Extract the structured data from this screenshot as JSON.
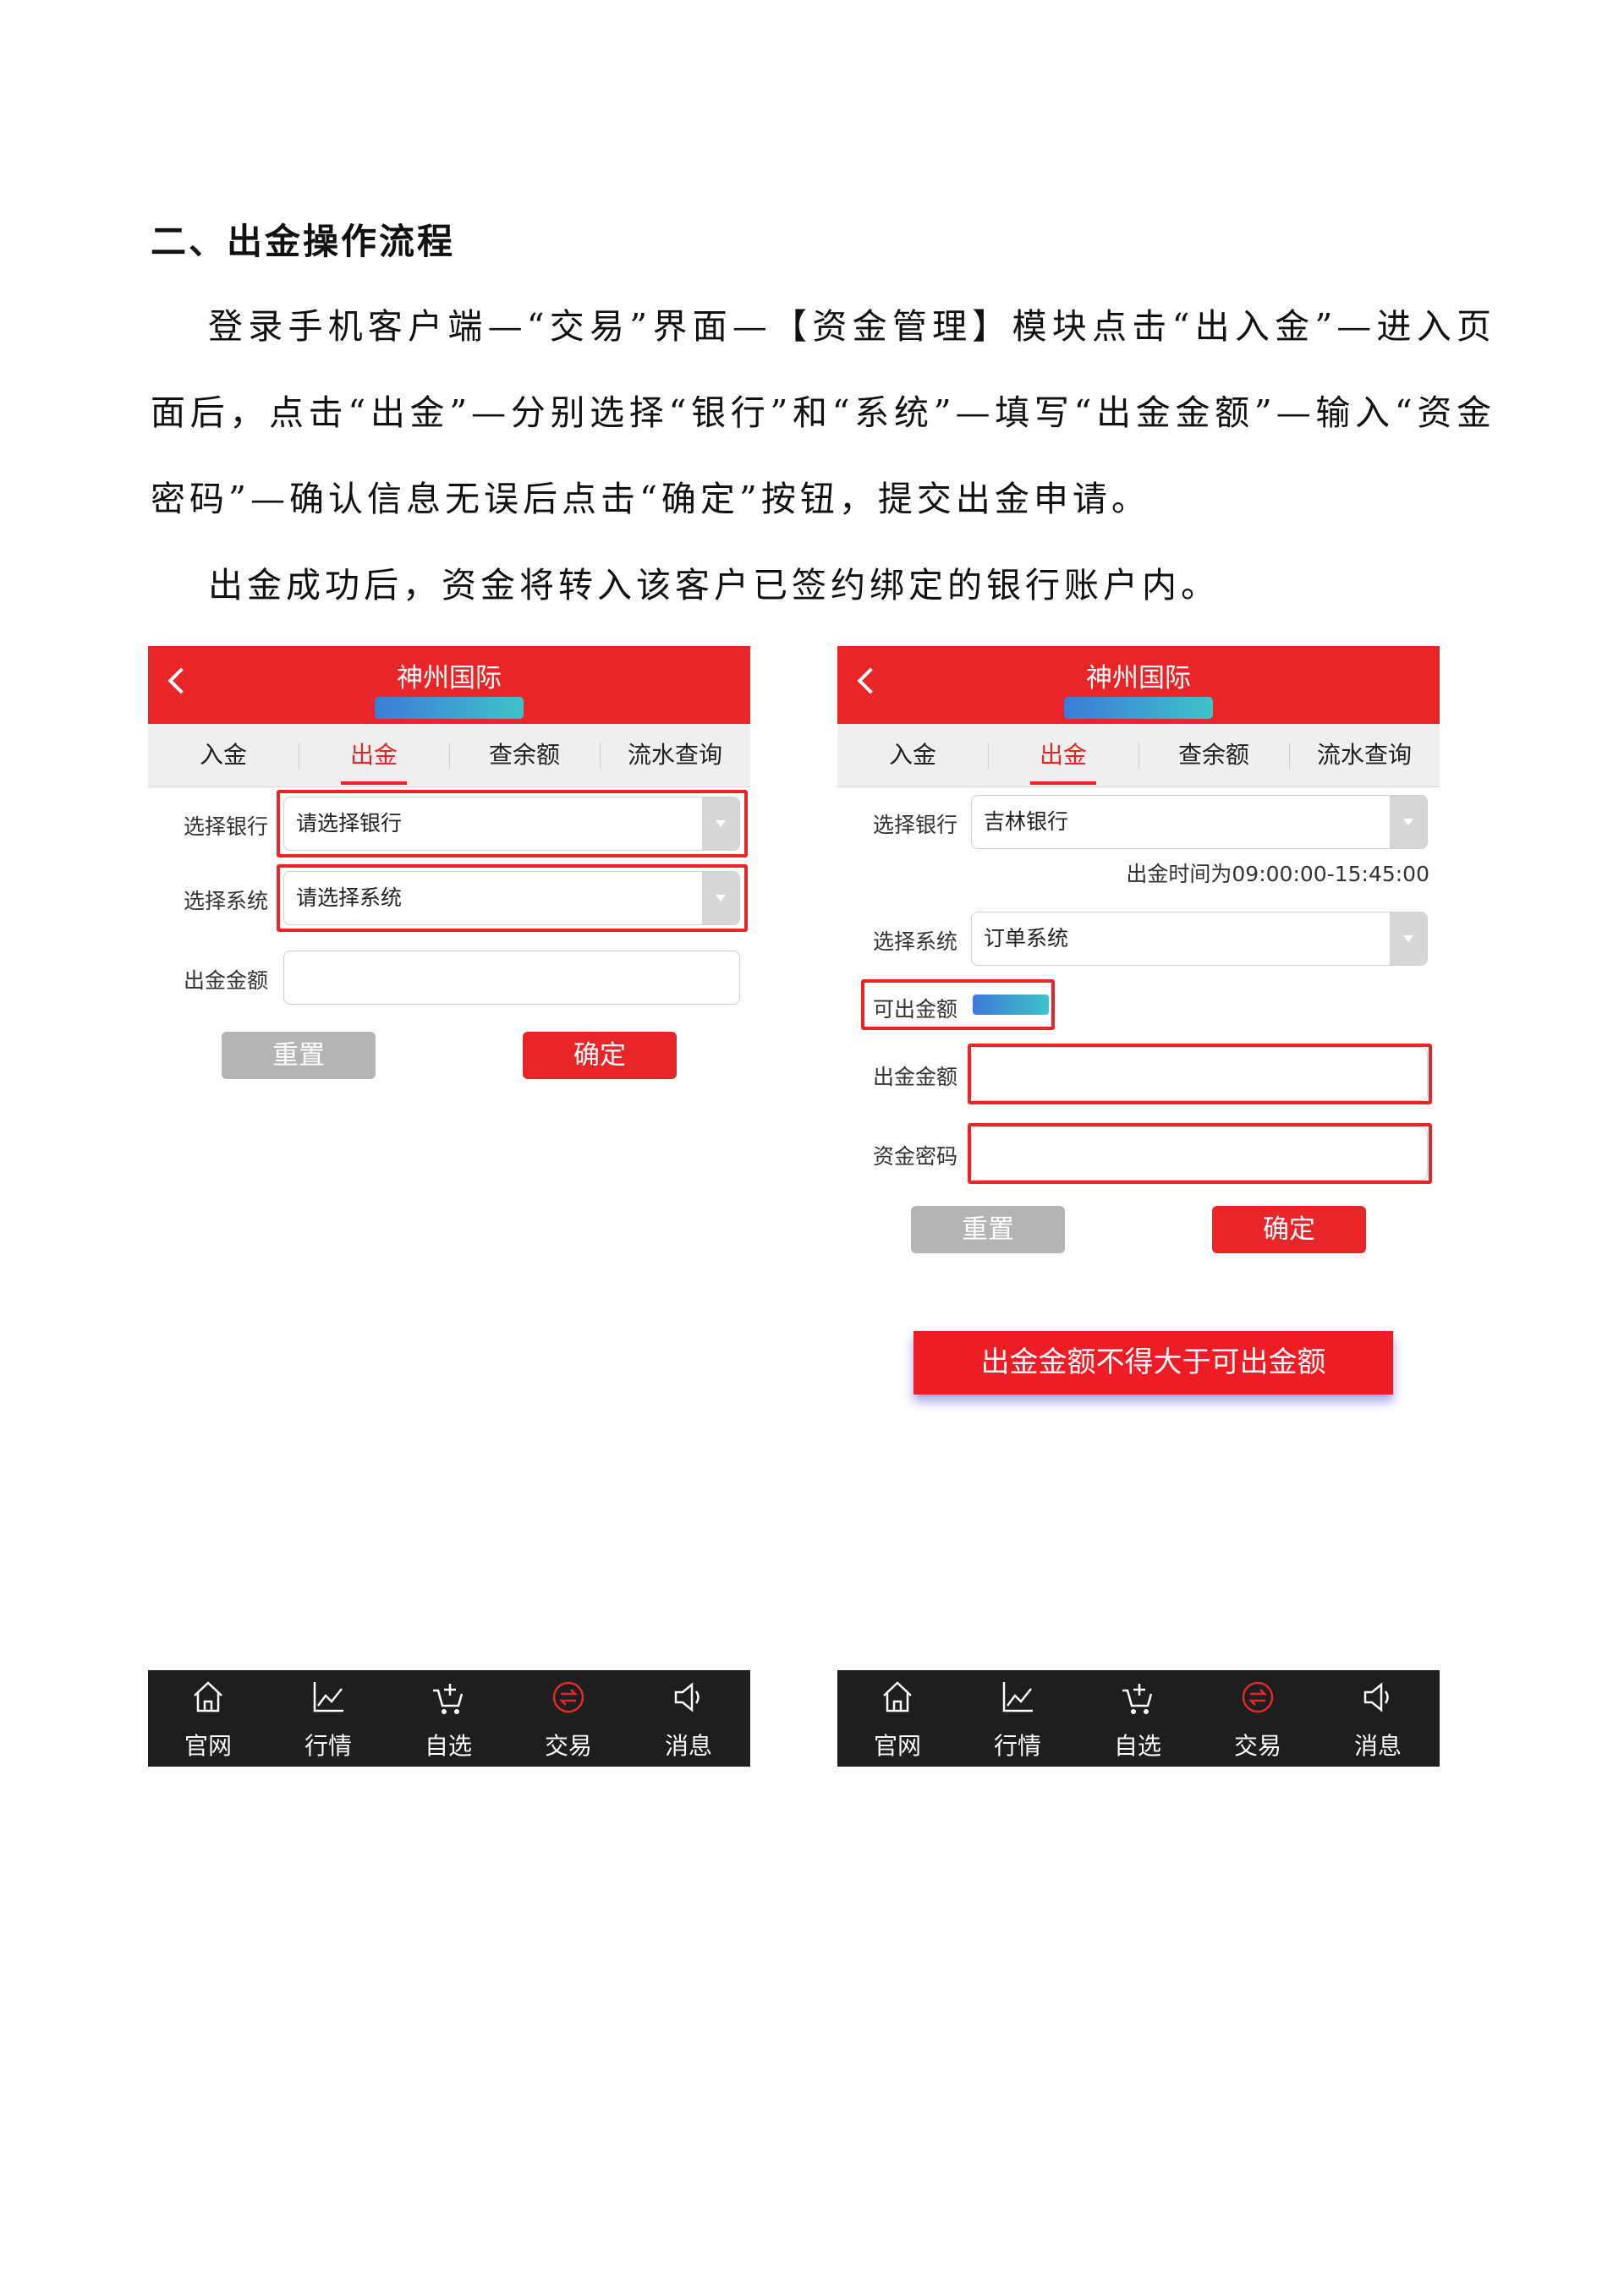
{
  "heading": "二、出金操作流程",
  "paragraph1": "登录手机客户端—“交易”界面—【资金管理】模块点击“出入金”—进入页面后，点击“出金”—分别选择“银行”和“系统”—填写“出金金额”—输入“资金密码”—确认信息无误后点击“确定”按钮，提交出金申请。",
  "paragraph2": "出金成功后，资金将转入该客户已签约绑定的银行账户内。",
  "colors": {
    "brand_red": "#e8262a",
    "dark_bar": "#1e1e1e",
    "reset_gray": "#b4b4b4"
  },
  "left_screen": {
    "title": "神州国际",
    "tabs": [
      "入金",
      "出金",
      "查余额",
      "流水查询"
    ],
    "active_tab": "出金",
    "bank_label": "选择银行",
    "bank_placeholder": "请选择银行",
    "system_label": "选择系统",
    "system_placeholder": "请选择系统",
    "amount_label": "出金金额",
    "reset_label": "重置",
    "confirm_label": "确定"
  },
  "right_screen": {
    "title": "神州国际",
    "tabs": [
      "入金",
      "出金",
      "查余额",
      "流水查询"
    ],
    "active_tab": "出金",
    "bank_label": "选择银行",
    "bank_value": "吉林银行",
    "time_note": "出金时间为09:00:00-15:45:00",
    "system_label": "选择系统",
    "system_value": "订单系统",
    "available_label": "可出金额",
    "amount_label": "出金金额",
    "password_label": "资金密码",
    "reset_label": "重置",
    "confirm_label": "确定"
  },
  "bottom_nav": {
    "items": [
      {
        "label": "官网",
        "icon": "home-icon"
      },
      {
        "label": "行情",
        "icon": "chart-icon"
      },
      {
        "label": "自选",
        "icon": "cart-icon"
      },
      {
        "label": "交易",
        "icon": "exchange-icon"
      },
      {
        "label": "消息",
        "icon": "speaker-icon"
      }
    ],
    "active": "交易"
  },
  "warning_note": "出金金额不得大于可出金额"
}
